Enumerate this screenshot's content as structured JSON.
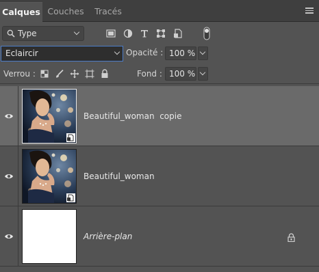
{
  "tabs": [
    {
      "label": "Calques",
      "active": true
    },
    {
      "label": "Couches",
      "active": false
    },
    {
      "label": "Tracés",
      "active": false
    }
  ],
  "filter": {
    "kind_label": "Type",
    "icons": [
      "image-filter-icon",
      "adjustment-filter-icon",
      "type-filter-icon",
      "shape-filter-icon",
      "smart-object-filter-icon",
      "filter-toggle-icon"
    ]
  },
  "blend": {
    "mode": "Eclaircir",
    "opacity_label": "Opacité :",
    "opacity_value": "100 %"
  },
  "lock": {
    "label": "Verrou :",
    "icons": [
      "lock-transparent-pixels-icon",
      "lock-image-pixels-icon",
      "lock-position-icon",
      "lock-artboard-icon",
      "lock-all-icon"
    ],
    "fill_label": "Fond :",
    "fill_value": "100 %"
  },
  "layers": [
    {
      "name": "Beautiful_woman  copie",
      "visible": true,
      "selected": true,
      "thumbnail": "photo",
      "smart_object": true,
      "locked": false
    },
    {
      "name": "Beautiful_woman",
      "visible": true,
      "selected": false,
      "thumbnail": "photo",
      "smart_object": true,
      "locked": false
    },
    {
      "name": "Arrière-plan",
      "visible": true,
      "selected": false,
      "thumbnail": "white",
      "smart_object": false,
      "locked": true
    }
  ],
  "colors": {
    "panel_bg": "#535353",
    "tabbar_bg": "#3f3f3f",
    "selected_row": "#6a6a6a",
    "focus_border": "#4d7dc8"
  }
}
